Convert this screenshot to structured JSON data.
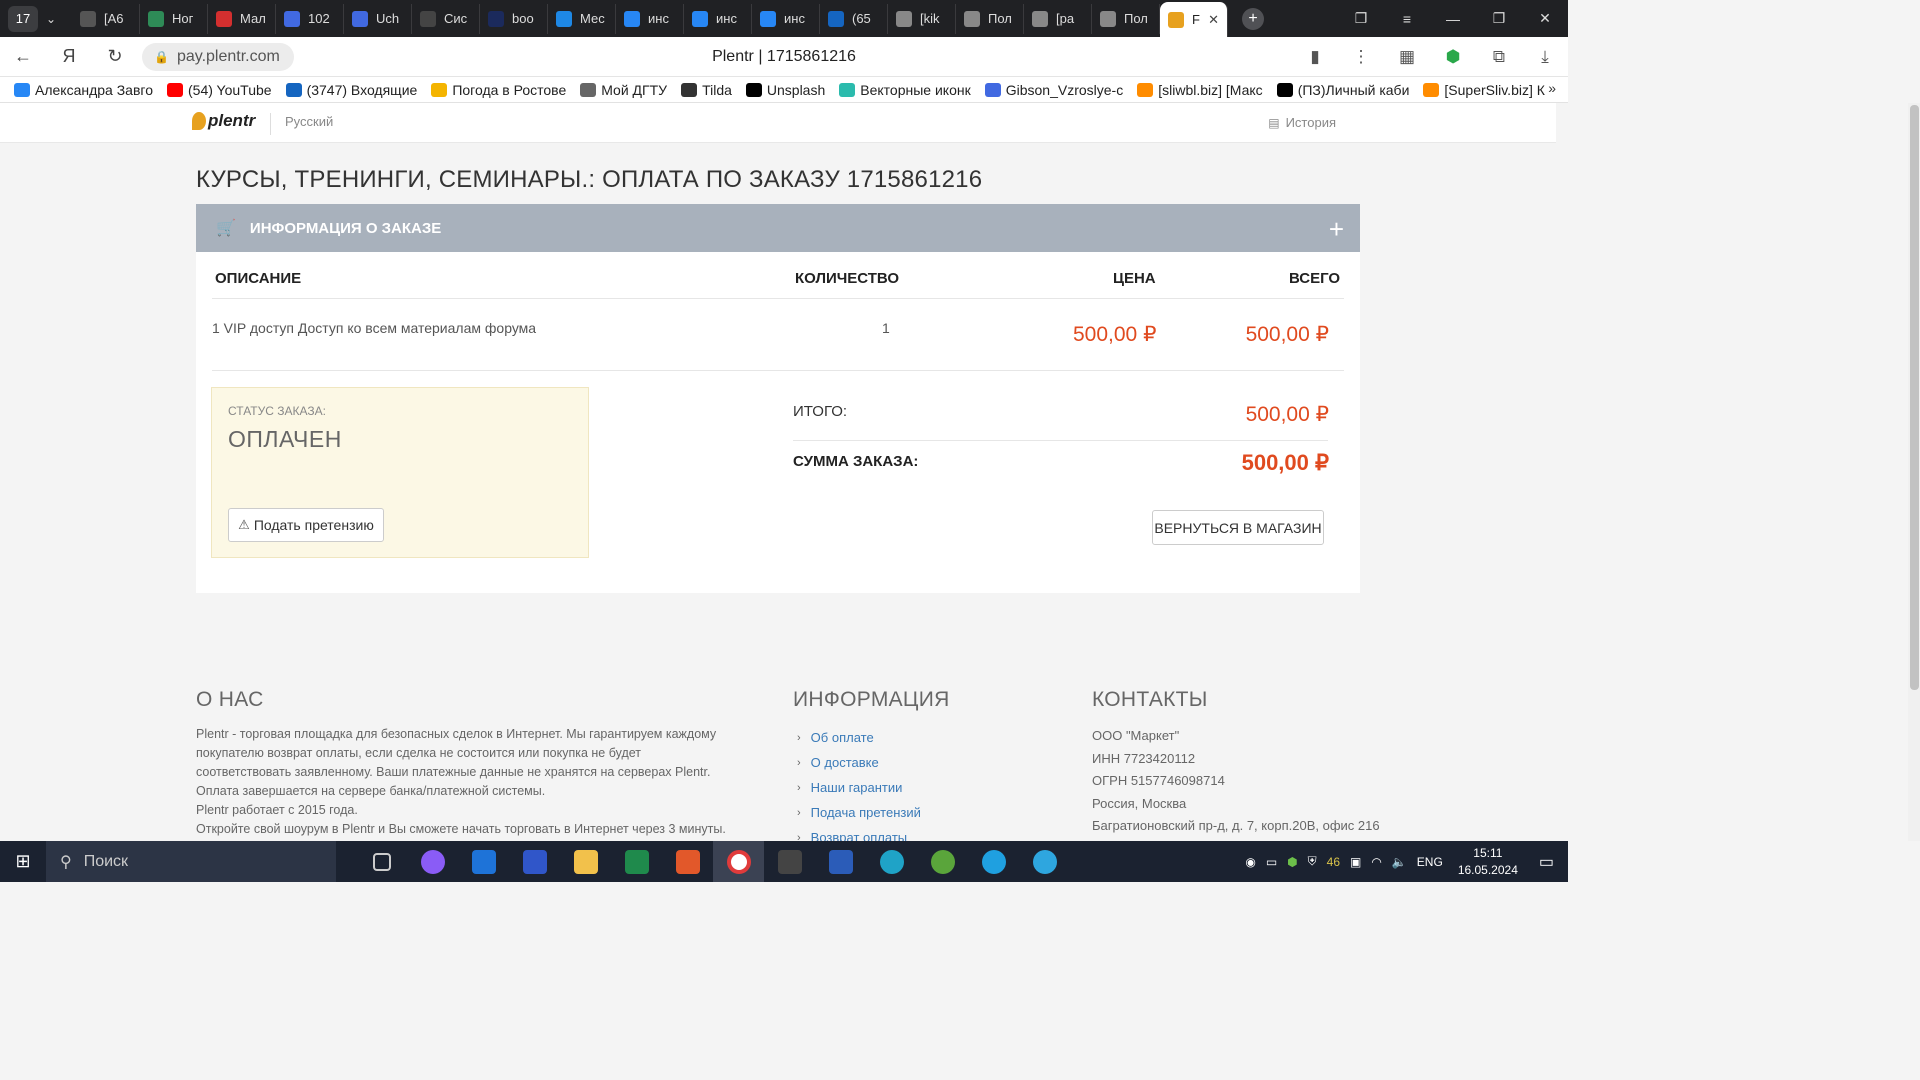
{
  "browser": {
    "tab_count": "17",
    "tabs": [
      {
        "label": "[А6",
        "color": "#555"
      },
      {
        "label": "Ног",
        "color": "#2e8b57"
      },
      {
        "label": "Мал",
        "color": "#d32f2f"
      },
      {
        "label": "102",
        "color": "#4169e1"
      },
      {
        "label": "Uch",
        "color": "#4169e1"
      },
      {
        "label": "Сис",
        "color": "#444"
      },
      {
        "label": "boo",
        "color": "#1b2a5c"
      },
      {
        "label": "Мес",
        "color": "#1e88e5"
      },
      {
        "label": "инс",
        "color": "#2787f5"
      },
      {
        "label": "инс",
        "color": "#2787f5"
      },
      {
        "label": "инс",
        "color": "#2787f5"
      },
      {
        "label": "(65",
        "color": "#1565c0"
      },
      {
        "label": "[kik",
        "color": "#888"
      },
      {
        "label": "Пол",
        "color": "#888"
      },
      {
        "label": "[ра",
        "color": "#888"
      },
      {
        "label": "Пол",
        "color": "#888"
      },
      {
        "label": "F",
        "color": "#e7a11f"
      }
    ],
    "url": "pay.plentr.com",
    "page_title": "Plentr | 1715861216",
    "bookmarks": [
      {
        "label": "Александра Завго",
        "color": "#2787f5"
      },
      {
        "label": "(54) YouTube",
        "color": "#ff0000"
      },
      {
        "label": "(3747) Входящие",
        "color": "#1565c0"
      },
      {
        "label": "Погода в Ростове",
        "color": "#f4b400"
      },
      {
        "label": "Мой ДГТУ",
        "color": "#666"
      },
      {
        "label": "Tilda",
        "color": "#333"
      },
      {
        "label": "Unsplash",
        "color": "#000"
      },
      {
        "label": "Векторные иконк",
        "color": "#2bbbad"
      },
      {
        "label": "Gibson_Vzroslye-c",
        "color": "#4169e1"
      },
      {
        "label": "[sliwbl.biz] [Макс",
        "color": "#ff8c00"
      },
      {
        "label": "(ПЗ)Личный каби",
        "color": "#000"
      },
      {
        "label": "[SuperSliv.biz] К",
        "color": "#ff8c00"
      }
    ]
  },
  "site": {
    "logo_text": "plentr",
    "language": "Русский",
    "history": "История"
  },
  "order": {
    "title": "КУРСЫ, ТРЕНИНГИ, СЕМИНАРЫ.: ОПЛАТА ПО ЗАКАЗУ 1715861216",
    "panel_title": "ИНФОРМАЦИЯ О ЗАКАЗЕ",
    "columns": {
      "description": "ОПИСАНИЕ",
      "quantity": "КОЛИЧЕСТВО",
      "price": "ЦЕНА",
      "total": "ВСЕГО"
    },
    "item": {
      "description": "1 VIP доступ Доступ ко всем материалам форума",
      "quantity": "1",
      "price": "500,00 ₽",
      "total": "500,00 ₽"
    },
    "status_label": "СТАТУС ЗАКАЗА:",
    "status_value": "ОПЛАЧЕН",
    "claim_button": "Подать претензию",
    "itogo_label": "ИТОГО:",
    "itogo_value": "500,00 ₽",
    "sum_label": "СУММА ЗАКАЗА:",
    "sum_value": "500,00 ₽",
    "back_button": "ВЕРНУТЬСЯ В МАГАЗИН"
  },
  "footer": {
    "about_title": "О НАС",
    "about_text_1": "Plentr - торговая площадка для безопасных сделок в Интернет. Мы гарантируем каждому покупателю возврат оплаты, если сделка не состоится или покупка не будет соответствовать заявленному. Ваши платежные данные не хранятся на серверах Plentr. Оплата завершается на сервере банка/платежной системы.",
    "about_text_2": "Plentr работает с 2015 года.",
    "about_text_3": "Откройте свой шоурум в Plentr и Вы сможете начать торговать в Интернет через 3 минуты.",
    "info_title": "ИНФОРМАЦИЯ",
    "info_links": [
      "Об оплате",
      "О доставке",
      "Наши гарантии",
      "Подача претензий",
      "Возврат оплаты"
    ],
    "contacts_title": "КОНТАКТЫ",
    "contacts": [
      "ООО \"Маркет\"",
      "ИНН 7723420112",
      "ОГРН 5157746098714",
      "Россия, Москва",
      "Багратионовский пр-д, д. 7, корп.20В, офис 216"
    ]
  },
  "taskbar": {
    "search_placeholder": "Поиск",
    "tray_temp": "46",
    "language": "ENG",
    "time": "15:11",
    "date": "16.05.2024"
  }
}
